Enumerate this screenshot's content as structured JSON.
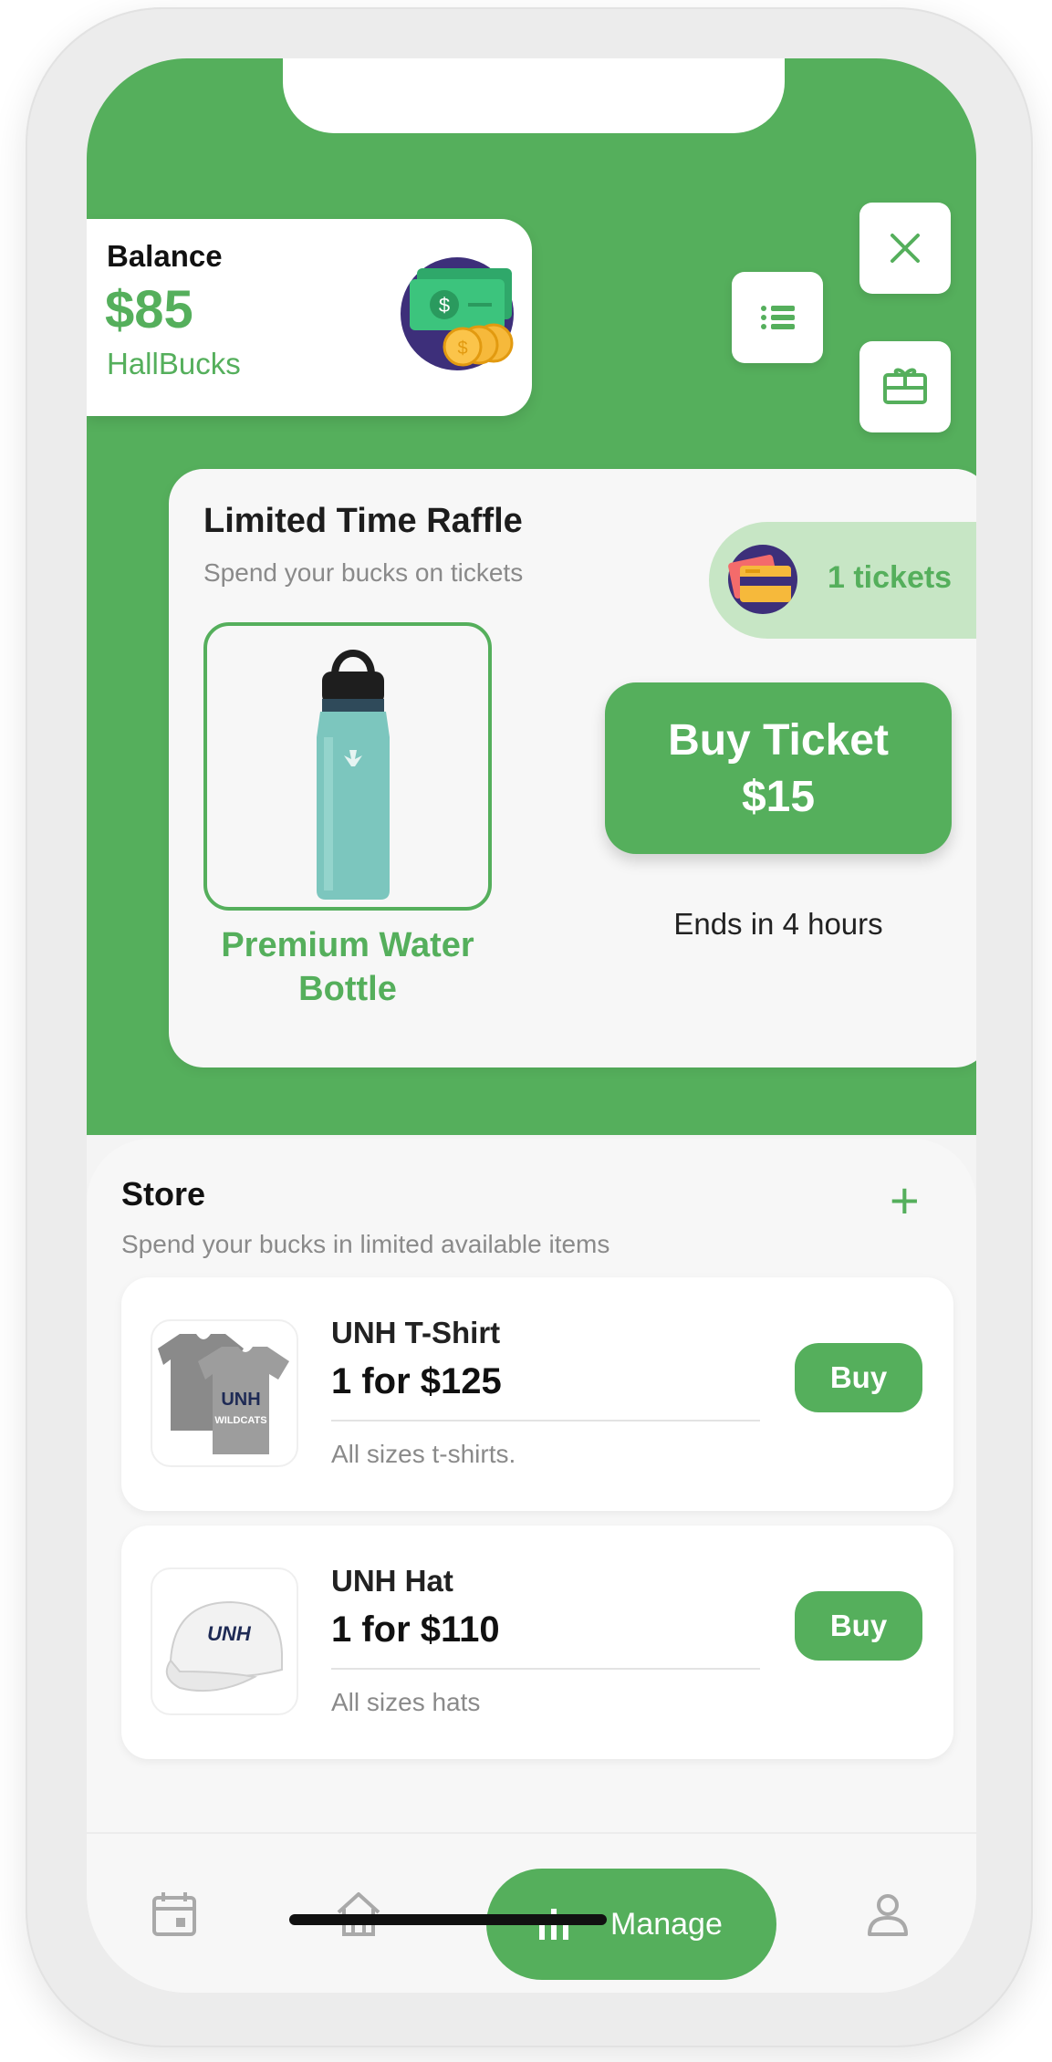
{
  "balance": {
    "label": "Balance",
    "value": "$85",
    "unit": "HallBucks"
  },
  "top_actions": {
    "icons": [
      "list-icon",
      "close-icon",
      "gift-icon"
    ]
  },
  "raffle": {
    "title": "Limited Time Raffle",
    "subtitle": "Spend your bucks on tickets",
    "tickets": "1 tickets",
    "prize_name": "Premium Water Bottle",
    "buy_button_label": "Buy Ticket",
    "buy_button_price": "$15",
    "ends_text": "Ends in 4 hours"
  },
  "store": {
    "title": "Store",
    "subtitle": "Spend your bucks in limited available items",
    "add_symbol": "+",
    "items": [
      {
        "name": "UNH T-Shirt",
        "price": "1 for $125",
        "description": "All sizes t-shirts.",
        "buy_label": "Buy"
      },
      {
        "name": "UNH Hat",
        "price": "1 for $110",
        "description": "All sizes hats",
        "buy_label": "Buy"
      }
    ]
  },
  "bottom_nav": {
    "items": [
      {
        "icon": "calendar-icon"
      },
      {
        "icon": "home-icon"
      },
      {
        "icon": "bar-chart-icon",
        "label": "Manage",
        "active": true
      },
      {
        "icon": "profile-icon"
      }
    ]
  },
  "colors": {
    "accent": "#55af5c",
    "accent_light": "#c7e6c5",
    "background": "#f4f4f4"
  }
}
